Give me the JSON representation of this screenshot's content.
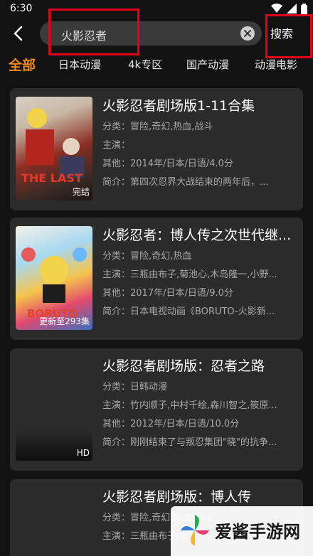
{
  "status": {
    "time": "6:30"
  },
  "search": {
    "query": "火影忍者",
    "button": "搜索"
  },
  "tabs": [
    {
      "label": "全部",
      "active": true
    },
    {
      "label": "日本动漫",
      "active": false
    },
    {
      "label": "4k专区",
      "active": false
    },
    {
      "label": "国产动漫",
      "active": false
    },
    {
      "label": "动漫电影",
      "active": false
    }
  ],
  "results": [
    {
      "title": "火影忍者剧场版1-11合集",
      "genre_label": "分类：",
      "genre": "冒险,奇幻,热血,战斗",
      "cast_label": "主演：",
      "cast": "",
      "other_label": "其他：",
      "other": "2014年/日本/日语/4.0分",
      "intro_label": "简介：",
      "intro": "第四次忍界大战结束的两年后，...",
      "badge": "完结"
    },
    {
      "title": "火影忍者：博人传之次世代继...",
      "genre_label": "分类：",
      "genre": "冒险,奇幻,热血",
      "cast_label": "主演：",
      "cast": "三瓶由布子,菊池心,木岛隆一,小野...",
      "other_label": "其他：",
      "other": "2017年/日本/日语/9.0分",
      "intro_label": "简介：",
      "intro": "日本电视动画《BORUTO-火影新...",
      "badge": "更新至293集"
    },
    {
      "title": "火影忍者剧场版：忍者之路",
      "genre_label": "分类：",
      "genre": "日韩动漫",
      "cast_label": "主演：",
      "cast": "竹内顺子,中村千绘,森川智之,筱原...",
      "other_label": "其他：",
      "other": "2012年/日本/日语/10.0分",
      "intro_label": "简介：",
      "intro": "刚刚结束了与叛忍集团\"晓\"的抗争...",
      "badge": "HD"
    },
    {
      "title": "火影忍者剧场版：博人传",
      "genre_label": "分类：",
      "genre": "冒险,奇幻,热血,战斗",
      "cast_label": "主演：",
      "cast": "三瓶由布子,菊",
      "other_label": "",
      "other": "",
      "intro_label": "",
      "intro": "",
      "badge": ""
    }
  ],
  "watermark": {
    "text": "爱酱手游网"
  },
  "colors": {
    "accent": "#f08a1a",
    "highlight": "#e3001b",
    "card": "#2b2b2b",
    "background": "#121212"
  }
}
